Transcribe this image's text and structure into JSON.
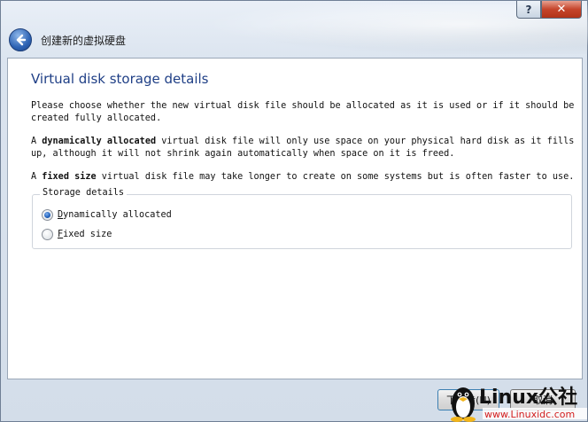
{
  "window": {
    "title": "创建新的虚拟硬盘",
    "help_glyph": "?",
    "close_glyph": "✕"
  },
  "page": {
    "heading": "Virtual disk storage details",
    "para1": "Please choose whether the new virtual disk file should be allocated as it is used or if it should be created fully allocated.",
    "para2_bold": "dynamically allocated",
    "para2_pre": "A ",
    "para2_post": " virtual disk file will only use space on your physical hard disk as it fills up, although it will not shrink again automatically when space on it is freed.",
    "para3_pre": "A ",
    "para3_bold": "fixed size",
    "para3_post": " virtual disk file may take longer to create on some systems but is often faster to use.",
    "storage_group": {
      "legend": "Storage details",
      "options": [
        {
          "label_first": "D",
          "label_rest": "ynamically allocated",
          "selected": true
        },
        {
          "label_first": "F",
          "label_rest": "ixed size",
          "selected": false
        }
      ]
    }
  },
  "footer": {
    "next_label": "下一步(N)",
    "cancel_label": "取消"
  },
  "watermark": {
    "brand": "Linux公社",
    "url": "www.Linuxidc.com"
  },
  "colors": {
    "heading": "#1f3f86",
    "close_button": "#c5452b",
    "back_button": "#2d63b4"
  }
}
